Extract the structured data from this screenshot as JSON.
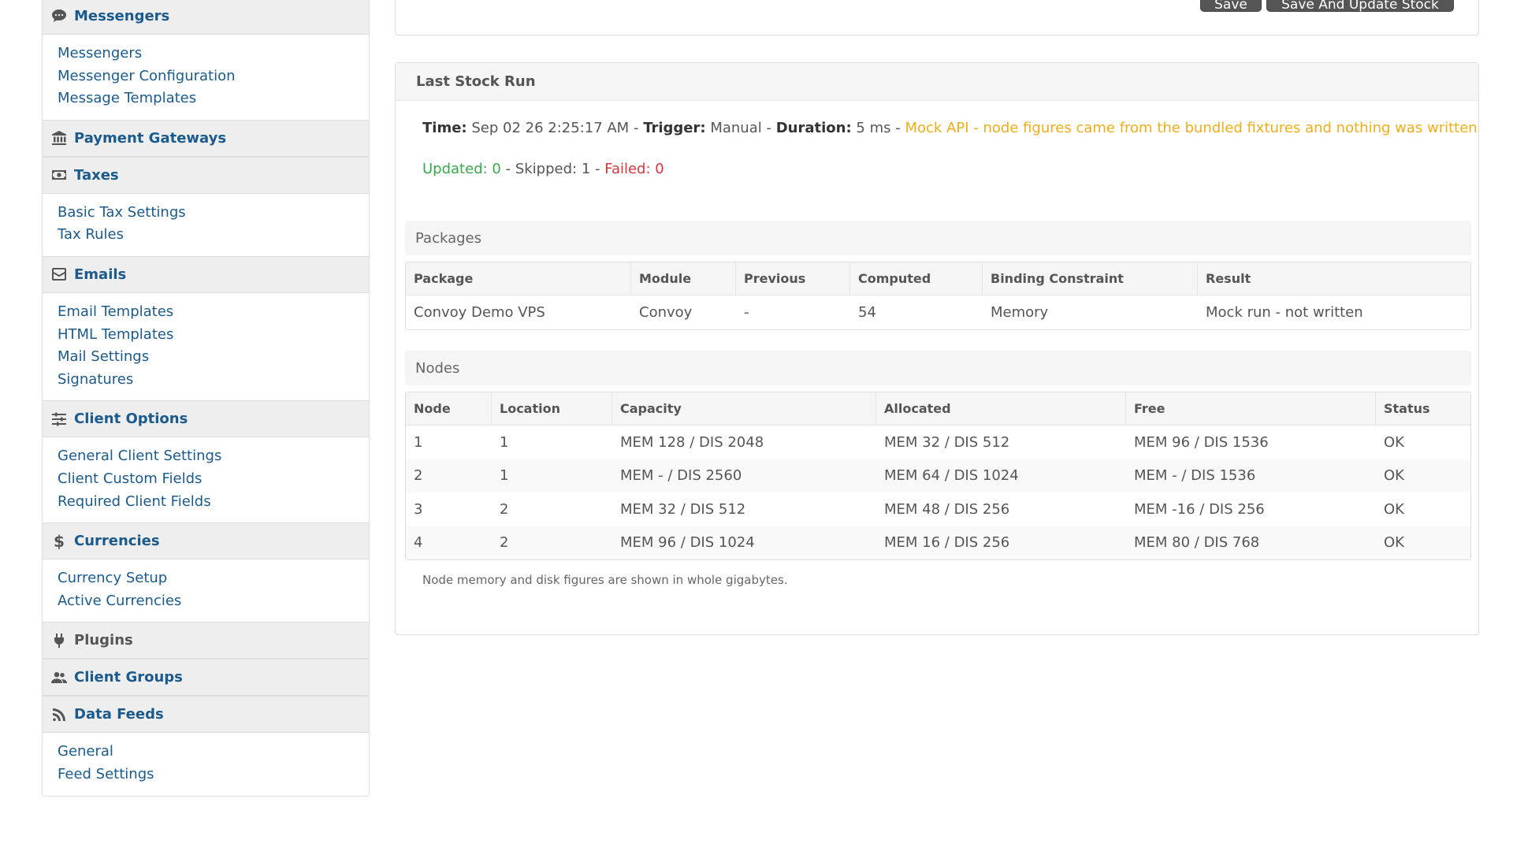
{
  "sidebar": {
    "sections": [
      {
        "title": "Messengers",
        "icon": "chat-bubble-icon",
        "items": [
          "Messengers",
          "Messenger Configuration",
          "Message Templates"
        ]
      },
      {
        "title": "Payment Gateways",
        "icon": "bank-icon",
        "items": []
      },
      {
        "title": "Taxes",
        "icon": "money-icon",
        "items": [
          "Basic Tax Settings",
          "Tax Rules"
        ]
      },
      {
        "title": "Emails",
        "icon": "envelope-icon",
        "items": [
          "Email Templates",
          "HTML Templates",
          "Mail Settings",
          "Signatures"
        ]
      },
      {
        "title": "Client Options",
        "icon": "sliders-icon",
        "items": [
          "General Client Settings",
          "Client Custom Fields",
          "Required Client Fields"
        ]
      },
      {
        "title": "Currencies",
        "icon": "dollar-icon",
        "items": [
          "Currency Setup",
          "Active Currencies"
        ]
      },
      {
        "title": "Plugins",
        "icon": "plug-icon",
        "items": []
      },
      {
        "title": "Client Groups",
        "icon": "users-icon",
        "items": []
      },
      {
        "title": "Data Feeds",
        "icon": "rss-icon",
        "items": [
          "General",
          "Feed Settings"
        ]
      }
    ]
  },
  "actions": {
    "save_label": "Save",
    "save_update_label": "Save And Update Stock"
  },
  "stock_run": {
    "title": "Last Stock Run",
    "time_label": "Time:",
    "time_value": "Sep 02 26 2:25:17 AM",
    "trigger_label": "Trigger:",
    "trigger_value": "Manual",
    "duration_label": "Duration:",
    "duration_value": "5 ms",
    "separator": "-",
    "mock_notice": "Mock API - node figures came from the bundled fixtures and nothing was written",
    "updated": "Updated: 0",
    "skipped": "Skipped: 1",
    "failed": "Failed: 0",
    "packages": {
      "title": "Packages",
      "columns": [
        "Package",
        "Module",
        "Previous",
        "Computed",
        "Binding Constraint",
        "Result"
      ],
      "rows": [
        [
          "Convoy Demo VPS",
          "Convoy",
          "-",
          "54",
          "Memory",
          "Mock run - not written"
        ]
      ]
    },
    "nodes": {
      "title": "Nodes",
      "columns": [
        "Node",
        "Location",
        "Capacity",
        "Allocated",
        "Free",
        "Status"
      ],
      "rows": [
        [
          "1",
          "1",
          "MEM 128 / DIS 2048",
          "MEM 32 / DIS 512",
          "MEM 96 / DIS 1536",
          "OK"
        ],
        [
          "2",
          "1",
          "MEM - / DIS 2560",
          "MEM 64 / DIS 1024",
          "MEM - / DIS 1536",
          "OK"
        ],
        [
          "3",
          "2",
          "MEM 32 / DIS 512",
          "MEM 48 / DIS 256",
          "MEM -16 / DIS 256",
          "OK"
        ],
        [
          "4",
          "2",
          "MEM 96 / DIS 1024",
          "MEM 16 / DIS 256",
          "MEM 80 / DIS 768",
          "OK"
        ]
      ]
    },
    "note": "Node memory and disk figures are shown in whole gigabytes."
  }
}
